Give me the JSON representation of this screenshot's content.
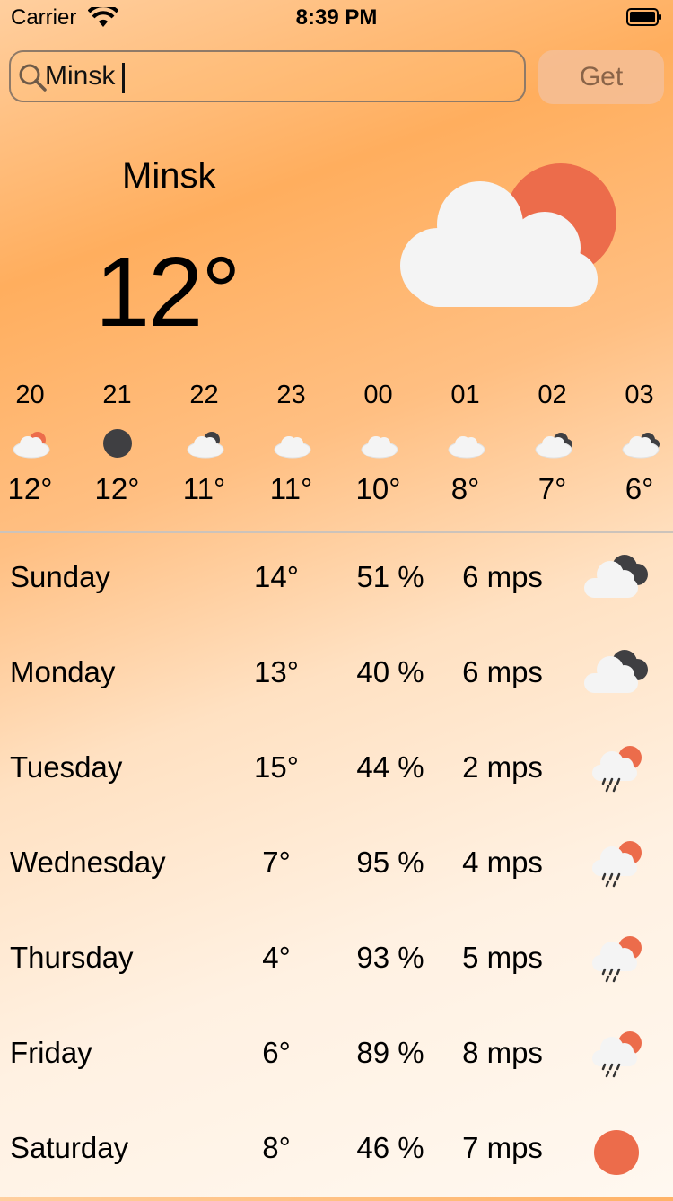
{
  "status_bar": {
    "carrier": "Carrier",
    "time": "8:39 PM"
  },
  "search": {
    "value": "Minsk",
    "button_label": "Get"
  },
  "current": {
    "city": "Minsk",
    "temperature": "12°",
    "icon": "sun-behind-cloud-icon"
  },
  "hourly": [
    {
      "hour": "20",
      "temp": "12°",
      "icon": "partly-cloudy-sun-icon"
    },
    {
      "hour": "21",
      "temp": "12°",
      "icon": "moon-icon"
    },
    {
      "hour": "22",
      "temp": "11°",
      "icon": "partly-cloudy-moon-icon"
    },
    {
      "hour": "23",
      "temp": "11°",
      "icon": "cloud-icon"
    },
    {
      "hour": "00",
      "temp": "10°",
      "icon": "cloud-icon"
    },
    {
      "hour": "01",
      "temp": "8°",
      "icon": "cloud-icon"
    },
    {
      "hour": "02",
      "temp": "7°",
      "icon": "overcast-icon"
    },
    {
      "hour": "03",
      "temp": "6°",
      "icon": "overcast-icon"
    }
  ],
  "daily": [
    {
      "day": "Sunday",
      "temp": "14°",
      "humidity": "51 %",
      "wind": "6 mps",
      "icon": "overcast-icon"
    },
    {
      "day": "Monday",
      "temp": "13°",
      "humidity": "40 %",
      "wind": "6 mps",
      "icon": "overcast-icon"
    },
    {
      "day": "Tuesday",
      "temp": "15°",
      "humidity": "44 %",
      "wind": "2 mps",
      "icon": "rain-sun-icon"
    },
    {
      "day": "Wednesday",
      "temp": "7°",
      "humidity": "95 %",
      "wind": "4 mps",
      "icon": "rain-sun-icon"
    },
    {
      "day": "Thursday",
      "temp": "4°",
      "humidity": "93 %",
      "wind": "5 mps",
      "icon": "rain-sun-icon"
    },
    {
      "day": "Friday",
      "temp": "6°",
      "humidity": "89 %",
      "wind": "8 mps",
      "icon": "rain-sun-icon"
    },
    {
      "day": "Saturday",
      "temp": "8°",
      "humidity": "46 %",
      "wind": "7 mps",
      "icon": "sun-icon"
    }
  ],
  "colors": {
    "sun": "#EC6C4B",
    "cloud": "#F4F4F4",
    "dark_cloud": "#3F3F42",
    "moon": "#3F3F42"
  }
}
